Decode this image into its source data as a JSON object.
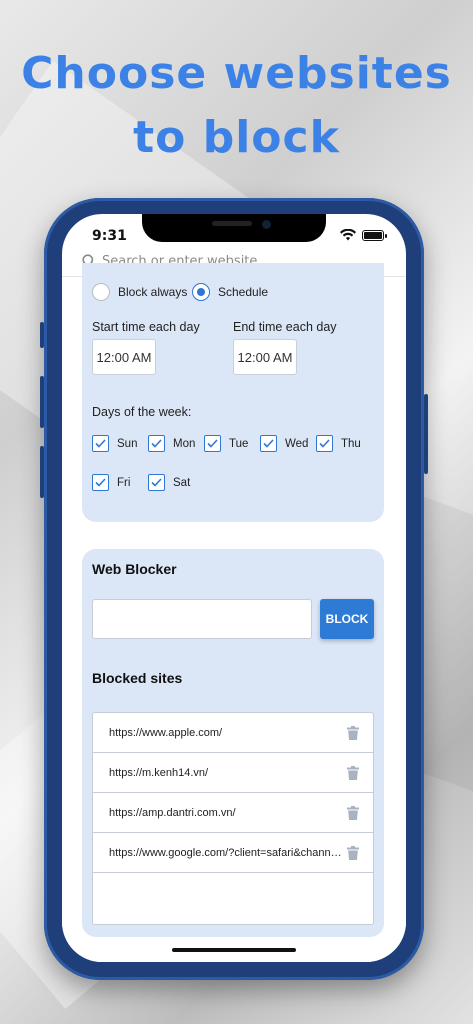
{
  "headline": {
    "line1": "Choose websites",
    "line2": "to block"
  },
  "colors": {
    "accent": "#2e7bd6",
    "headline": "#3c82e6",
    "card": "#dbe6f6"
  },
  "status_bar": {
    "time": "9:31"
  },
  "search": {
    "placeholder": "Search or enter website",
    "icon": "search-icon"
  },
  "schedule": {
    "options": [
      {
        "label": "Block always",
        "selected": false
      },
      {
        "label": "Schedule",
        "selected": true
      }
    ],
    "start_label": "Start time each day",
    "start_value": "12:00 AM",
    "end_label": "End time each day",
    "end_value": "12:00 AM",
    "days_label": "Days of the week:",
    "days": [
      {
        "label": "Sun",
        "checked": true
      },
      {
        "label": "Mon",
        "checked": true
      },
      {
        "label": "Tue",
        "checked": true
      },
      {
        "label": "Wed",
        "checked": true
      },
      {
        "label": "Thu",
        "checked": true
      },
      {
        "label": "Fri",
        "checked": true
      },
      {
        "label": "Sat",
        "checked": true
      }
    ]
  },
  "blocker": {
    "title": "Web Blocker",
    "input_value": "",
    "button_label": "BLOCK",
    "list_title": "Blocked sites",
    "sites": [
      "https://www.apple.com/",
      "https://m.kenh14.vn/",
      "https://amp.dantri.com.vn/",
      "https://www.google.com/?client=safari&channel=ip..."
    ]
  }
}
